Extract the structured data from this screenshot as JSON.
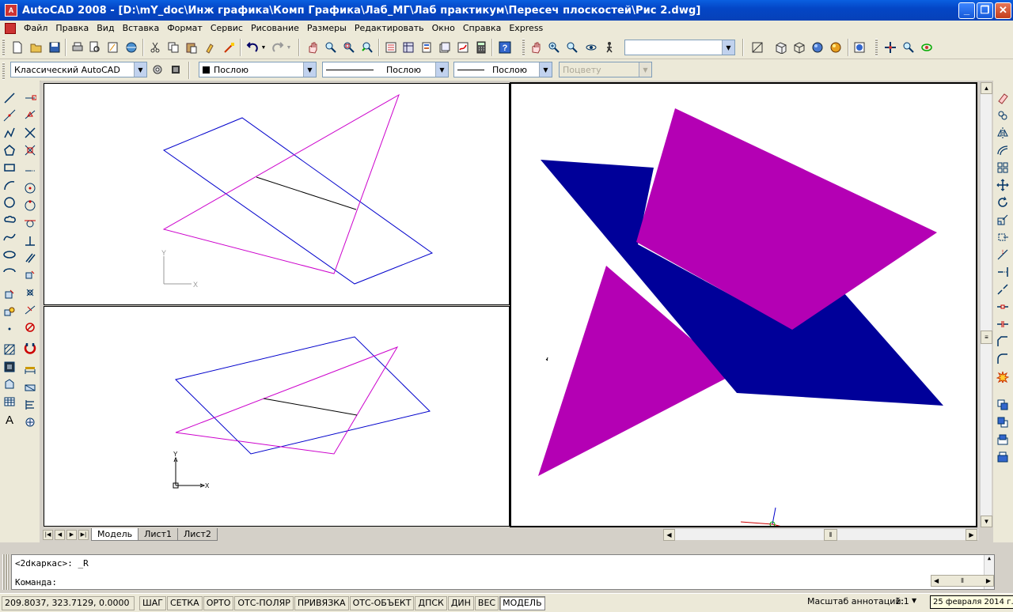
{
  "window": {
    "title": "AutoCAD 2008 - [D:\\mY_doc\\Инж графика\\Комп Графика\\Лаб_МГ\\Лаб практикум\\Пересеч плоскостей\\Рис 2.dwg]",
    "minimize_glyph": "_",
    "restore_glyph": "❐",
    "close_glyph": "✕"
  },
  "menu": {
    "items": [
      "Файл",
      "Правка",
      "Вид",
      "Вставка",
      "Формат",
      "Сервис",
      "Рисование",
      "Размеры",
      "Редактировать",
      "Окно",
      "Справка",
      "Express"
    ],
    "doc_controls": [
      "_",
      "❐",
      "✕"
    ]
  },
  "toolbar_standard": {
    "icons": [
      "new-icon",
      "open-icon",
      "save-icon",
      "print-icon",
      "preview-icon",
      "publish-icon",
      "plot-3d-icon",
      "cut-icon",
      "copy-icon",
      "paste-icon",
      "match-properties-icon",
      "undo-icon",
      "redo-icon",
      "pan-icon",
      "zoom-realtime-icon",
      "zoom-window-icon",
      "zoom-previous-icon",
      "properties-icon",
      "designcenter-icon",
      "tool-palettes-icon",
      "sheetset-icon",
      "markup-icon",
      "quickcalc-icon",
      "help-icon"
    ],
    "named_view_value": ""
  },
  "toolbar_styles": {
    "workspace": "Классический AutoCAD",
    "layer": "Послою",
    "linetype": "Послою",
    "lineweight": "Послою",
    "plotstyle": "Поцвету"
  },
  "left_draw_tools": [
    "line-icon",
    "construction-line-icon",
    "polyline-icon",
    "polygon-icon",
    "rectangle-icon",
    "arc-icon",
    "circle-icon",
    "revision-cloud-icon",
    "spline-icon",
    "ellipse-icon",
    "ellipse-arc-icon",
    "insert-block-icon",
    "make-block-icon",
    "point-icon",
    "hatch-icon",
    "gradient-icon",
    "region-icon",
    "table-icon",
    "multiline-text-icon"
  ],
  "left_snap_tools": [
    "snap-endpoint-icon",
    "snap-midpoint-icon",
    "snap-intersection-icon",
    "snap-apparent-icon",
    "snap-extension-icon",
    "snap-center-icon",
    "snap-quadrant-icon",
    "snap-tangent-icon",
    "snap-perpendicular-icon",
    "snap-parallel-icon",
    "snap-insert-icon",
    "snap-node-icon",
    "snap-nearest-icon",
    "snap-none-icon",
    "osnap-settings-icon",
    "dim-linear-icon",
    "dim-aligned-icon",
    "dim-style-icon",
    "leader-icon"
  ],
  "right_modify_tools": [
    "erase-icon",
    "copy-object-icon",
    "mirror-icon",
    "offset-icon",
    "array-icon",
    "move-icon",
    "rotate-icon",
    "scale-icon",
    "stretch-icon",
    "trim-icon",
    "extend-icon",
    "break-at-point-icon",
    "break-icon",
    "join-icon",
    "chamfer-icon",
    "fillet-icon",
    "explode-icon",
    "draworder-front-icon",
    "draworder-back-icon",
    "draworder-above-icon",
    "draworder-under-icon"
  ],
  "layout_tabs": [
    "Модель",
    "Лист1",
    "Лист2"
  ],
  "active_tab": "Модель",
  "viewport_top_left": {
    "ucs_x": "X",
    "ucs_y": "Y"
  },
  "viewport_bottom_left": {
    "ucs_x": "X",
    "ucs_y": "Y"
  },
  "colors": {
    "blue_plane": "#000099",
    "magenta_plane": "#b400b4",
    "blue_line": "#0000cc",
    "magenta_line": "#cc00cc",
    "intersection_line": "#000000"
  },
  "command": {
    "history_line": "<2dкаркас>: _R",
    "prompt": "Команда:"
  },
  "status": {
    "coordinates": "209.8037, 323.7129, 0.0000",
    "toggles": [
      "ШАГ",
      "СЕТКА",
      "ОРТО",
      "ОТС-ПОЛЯР",
      "ПРИВЯЗКА",
      "ОТС-ОБЪЕКТ",
      "ДПСК",
      "ДИН",
      "ВЕС",
      "МОДЕЛЬ"
    ],
    "active_toggle": "МОДЕЛЬ",
    "annotation_scale_label": "Масштаб аннотаций:",
    "annotation_scale_value": "1:1",
    "date_tooltip": "25 февраля 2014 г."
  }
}
